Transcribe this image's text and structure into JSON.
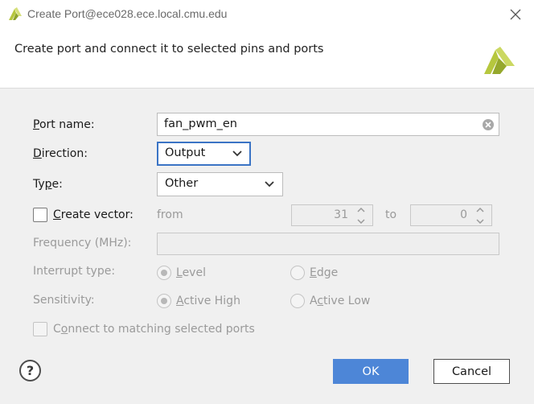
{
  "window": {
    "title": "Create Port@ece028.ece.local.cmu.edu"
  },
  "header": {
    "description": "Create port and connect it to selected pins and ports"
  },
  "form": {
    "port_name": {
      "label_mnemonic": "P",
      "label_rest": "ort name:",
      "value": "fan_pwm_en"
    },
    "direction": {
      "label_mnemonic": "D",
      "label_rest": "irection:",
      "value": "Output"
    },
    "type": {
      "label_pre": "Ty",
      "label_mnemonic": "p",
      "label_post": "e:",
      "value": "Other"
    },
    "create_vector": {
      "label_mnemonic": "C",
      "label_rest": "reate vector:",
      "checked": false,
      "from_label": "from",
      "from_value": "31",
      "to_label": "to",
      "to_value": "0"
    },
    "frequency": {
      "label": "Frequency (MHz):",
      "value": ""
    },
    "interrupt_type": {
      "label": "Interrupt type:",
      "options": [
        {
          "mnemonic": "L",
          "rest": "evel",
          "selected": true
        },
        {
          "mnemonic": "E",
          "rest": "dge",
          "selected": false
        }
      ]
    },
    "sensitivity": {
      "label": "Sensitivity:",
      "options": [
        {
          "mnemonic": "A",
          "rest": "ctive High",
          "selected": true
        },
        {
          "pre": "A",
          "mnemonic": "c",
          "rest": "tive Low",
          "selected": false
        }
      ]
    },
    "connect_matching": {
      "mnemonic": "o",
      "pre": "C",
      "rest": "nnect to matching selected ports",
      "checked": false
    }
  },
  "footer": {
    "help_label": "?",
    "ok_label": "OK",
    "cancel_label": "Cancel"
  },
  "colors": {
    "accent": "#4d86d7",
    "focus": "#3b74c5",
    "logo": "#b6c73e"
  }
}
